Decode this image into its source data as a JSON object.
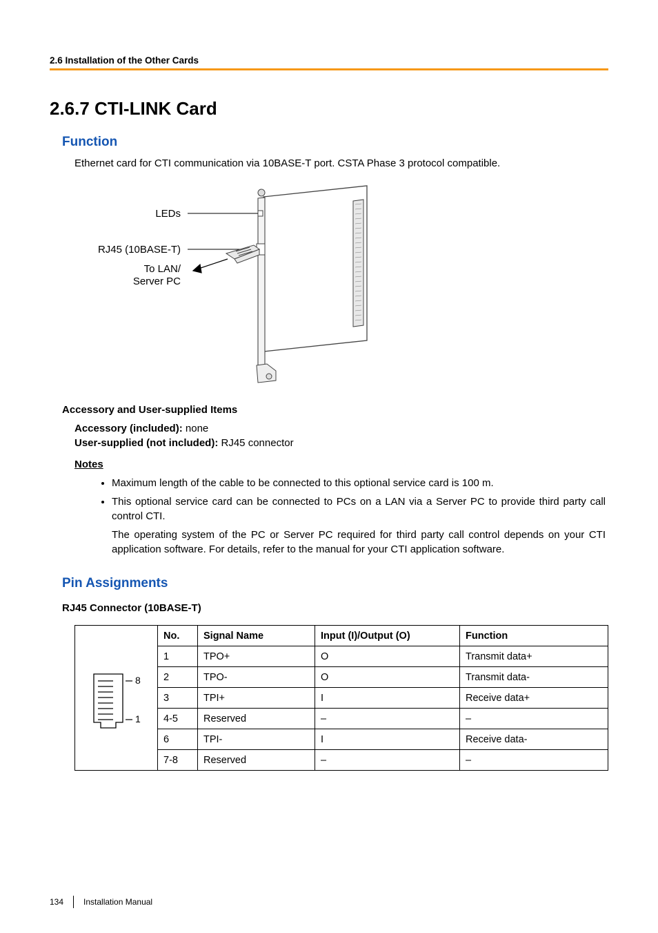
{
  "header": {
    "breadcrumb": "2.6 Installation of the Other Cards"
  },
  "section": {
    "number_title": "2.6.7   CTI-LINK Card",
    "function_heading": "Function",
    "function_text": "Ethernet card for CTI communication via 10BASE-T port. CSTA Phase 3 protocol compatible.",
    "figure_labels": {
      "leds": "LEDs",
      "rj45": "RJ45 (10BASE-T)",
      "to_lan1": "To LAN/",
      "to_lan2": "Server PC"
    },
    "accessory_heading": "Accessory and User-supplied Items",
    "accessory_line_label": "Accessory (included):",
    "accessory_line_value": " none",
    "user_supplied_label": "User-supplied (not included):",
    "user_supplied_value": " RJ45 connector",
    "notes_heading": "Notes",
    "notes": [
      "Maximum length of the cable to be connected to this optional service card is 100 m.",
      "This optional service card can be connected to PCs on a LAN via a Server PC to provide third party call control CTI."
    ],
    "notes_tail": "The operating system of the PC or Server PC required for third party call control depends on your CTI application software. For details, refer to the manual for your CTI application software.",
    "pin_heading": "Pin Assignments",
    "rj_heading": "RJ45 Connector (10BASE-T)",
    "table": {
      "headers": {
        "no": "No.",
        "signal": "Signal Name",
        "io": "Input (I)/Output (O)",
        "func": "Function"
      },
      "rows": [
        {
          "no": "1",
          "signal": "TPO+",
          "io": "O",
          "func": "Transmit data+"
        },
        {
          "no": "2",
          "signal": "TPO-",
          "io": "O",
          "func": "Transmit data-"
        },
        {
          "no": "3",
          "signal": "TPI+",
          "io": "I",
          "func": "Receive data+"
        },
        {
          "no": "4-5",
          "signal": "Reserved",
          "io": "–",
          "func": "–"
        },
        {
          "no": "6",
          "signal": "TPI-",
          "io": "I",
          "func": "Receive data-"
        },
        {
          "no": "7-8",
          "signal": "Reserved",
          "io": "–",
          "func": "–"
        }
      ],
      "connector_top": "8",
      "connector_bottom": "1"
    }
  },
  "footer": {
    "page": "134",
    "doc": "Installation Manual"
  }
}
